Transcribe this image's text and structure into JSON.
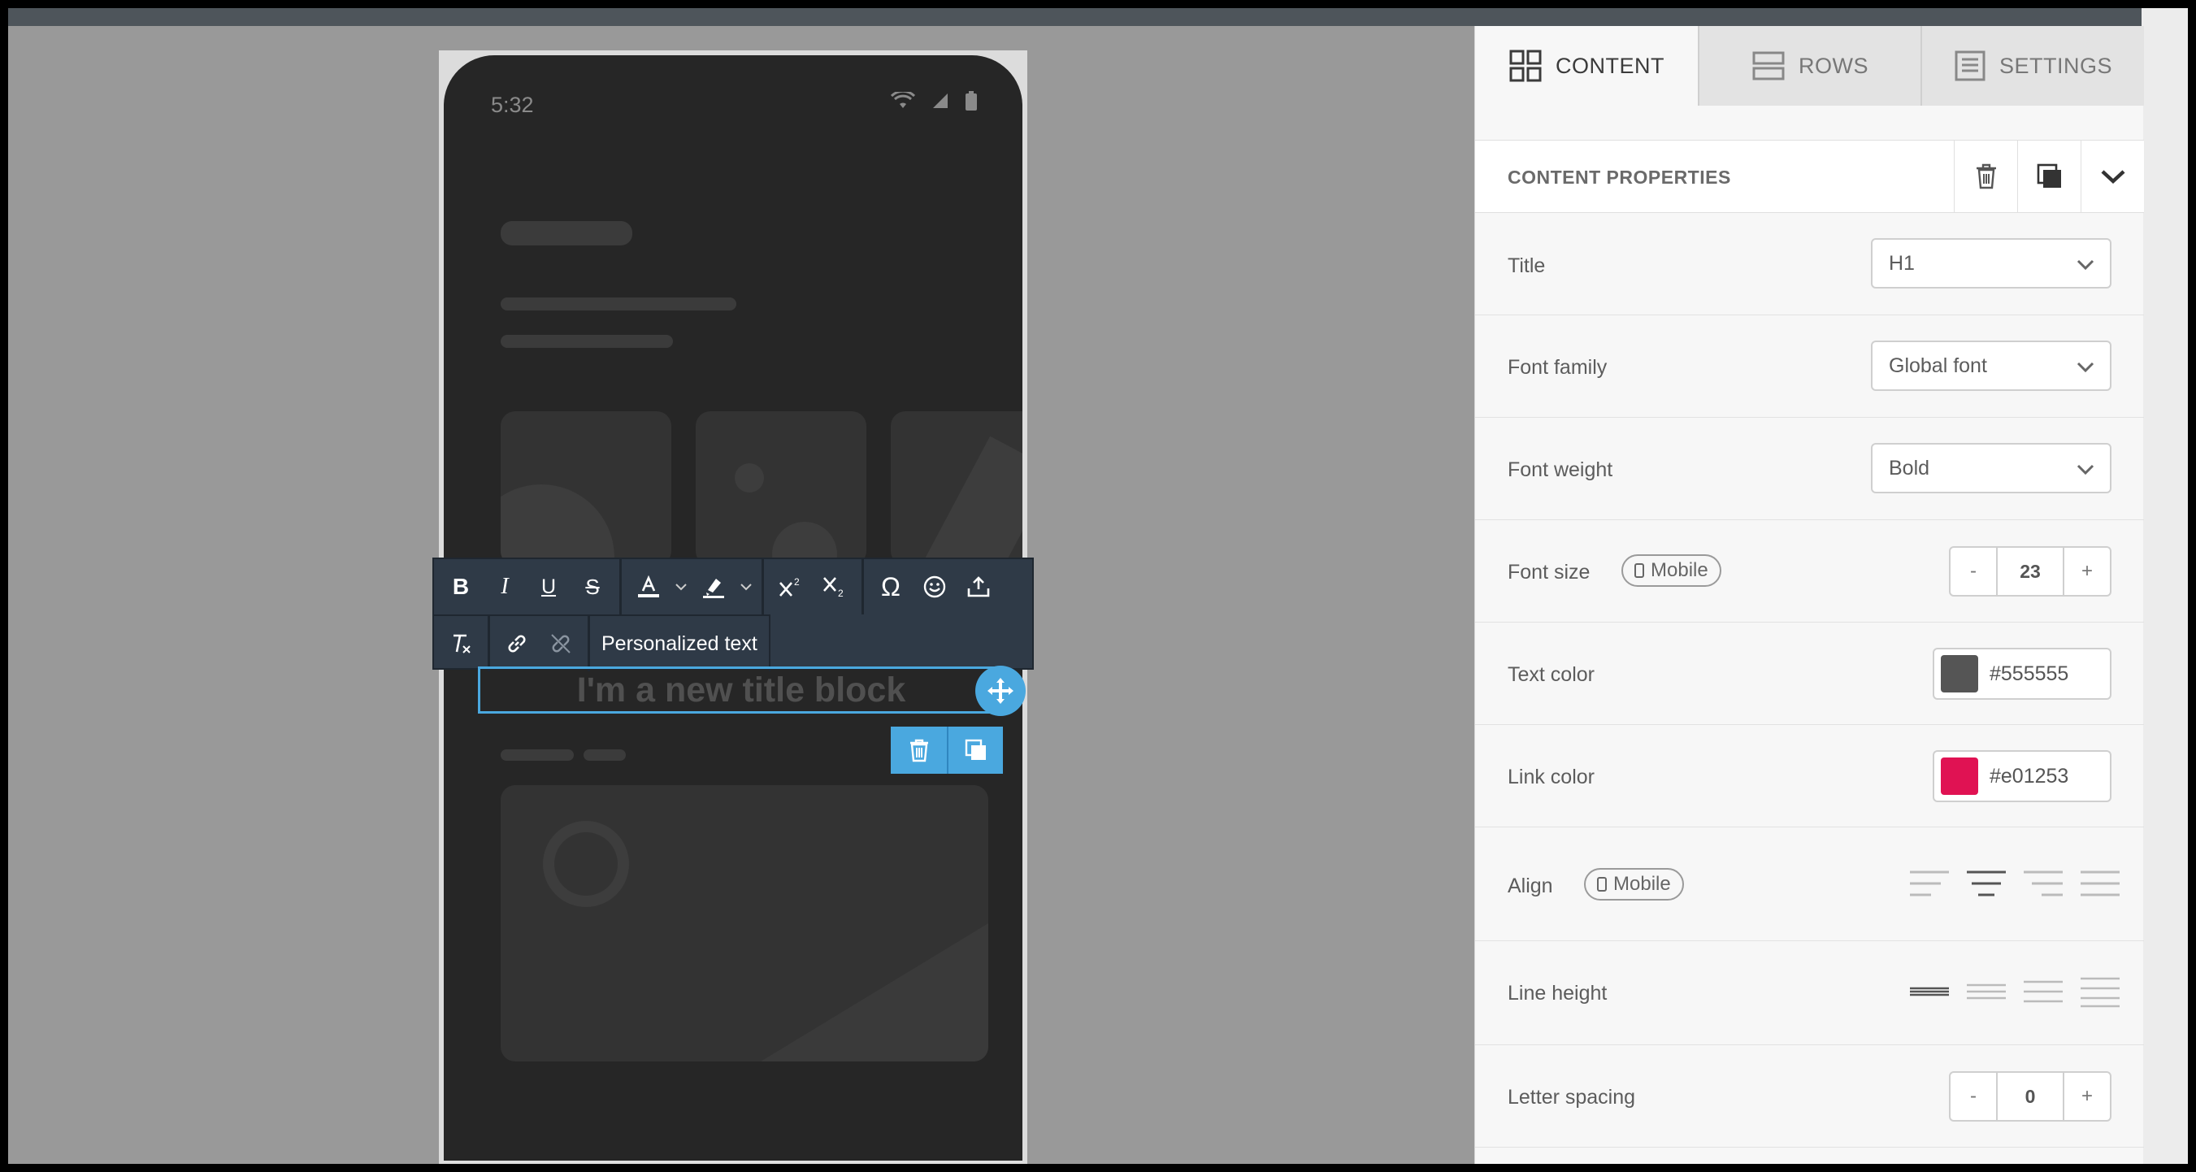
{
  "phone": {
    "time": "5:32"
  },
  "toolbar": {
    "bold": "B",
    "italic": "I",
    "underline": "U",
    "strike": "S",
    "personalized_text": "Personalized text"
  },
  "title_block": {
    "text": "I'm a new title block"
  },
  "tabs": [
    {
      "label": "CONTENT",
      "icon": "grid-icon",
      "active": true
    },
    {
      "label": "ROWS",
      "icon": "rows-icon",
      "active": false
    },
    {
      "label": "SETTINGS",
      "icon": "settings-doc-icon",
      "active": false
    }
  ],
  "content_properties": {
    "header": "CONTENT PROPERTIES",
    "title": {
      "label": "Title",
      "value": "H1"
    },
    "font_family": {
      "label": "Font family",
      "value": "Global font"
    },
    "font_weight": {
      "label": "Font weight",
      "value": "Bold"
    },
    "font_size": {
      "label": "Font size",
      "badge": "Mobile",
      "value": "23",
      "minus": "-",
      "plus": "+"
    },
    "text_color": {
      "label": "Text color",
      "value": "#555555"
    },
    "link_color": {
      "label": "Link color",
      "value": "#e01253"
    },
    "align": {
      "label": "Align",
      "badge": "Mobile",
      "selected": "center"
    },
    "line_height": {
      "label": "Line height"
    },
    "letter_spacing": {
      "label": "Letter spacing",
      "value": "0",
      "minus": "-",
      "plus": "+"
    }
  },
  "colors": {
    "accent": "#4aa8df",
    "toolbar_bg": "#2f3a47",
    "text_color_swatch": "#555555",
    "link_color_swatch": "#e01253"
  }
}
